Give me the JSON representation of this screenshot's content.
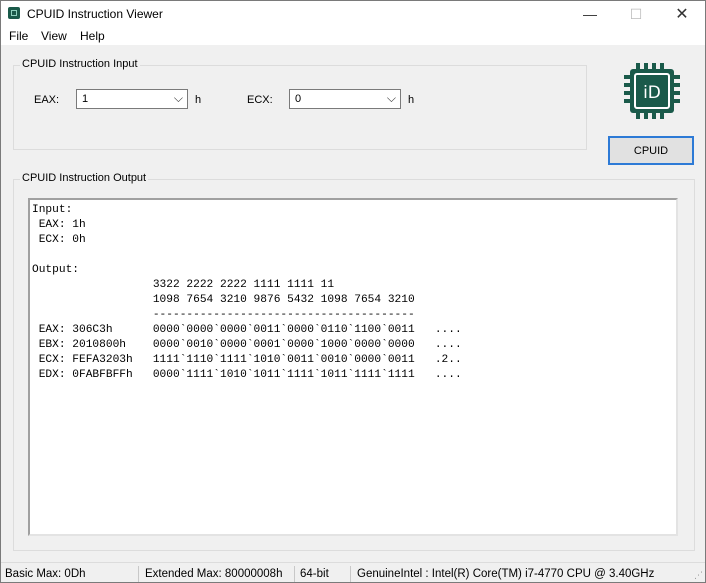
{
  "window": {
    "title": "CPUID Instruction Viewer",
    "minimize_glyph": "—",
    "maximize_glyph": "☐",
    "close_glyph": "✕"
  },
  "menu": [
    "File",
    "View",
    "Help"
  ],
  "input_group": {
    "legend": "CPUID Instruction Input",
    "eax_label": "EAX:",
    "eax_value": "1",
    "ecx_label": "ECX:",
    "ecx_value": "0",
    "unit": "h"
  },
  "logo": {
    "text": "iD",
    "icon": "cpu-chip-icon",
    "color": "#1a5a4a"
  },
  "cpuid_button": "CPUID",
  "output_group": {
    "legend": "CPUID Instruction Output",
    "text": "Input:\n EAX: 1h\n ECX: 0h\n\nOutput:\n                  3322 2222 2222 1111 1111 11\n                  1098 7654 3210 9876 5432 1098 7654 3210\n                  ---------------------------------------\n EAX: 306C3h      0000`0000`0000`0011`0000`0110`1100`0011   ....\n EBX: 2010800h    0000`0010`0000`0001`0000`1000`0000`0000   ....\n ECX: FEFA3203h   1111`1110`1111`1010`0011`0010`0000`0011   .2..\n EDX: 0FABFBFFh   0000`1111`1010`1011`1111`1011`1111`1111   ...."
  },
  "status": {
    "basic_max": "Basic Max: 0Dh",
    "extended_max": "Extended Max: 80000008h",
    "bitness": "64-bit",
    "cpu": "GenuineIntel : Intel(R) Core(TM) i7-4770 CPU @ 3.40GHz"
  }
}
